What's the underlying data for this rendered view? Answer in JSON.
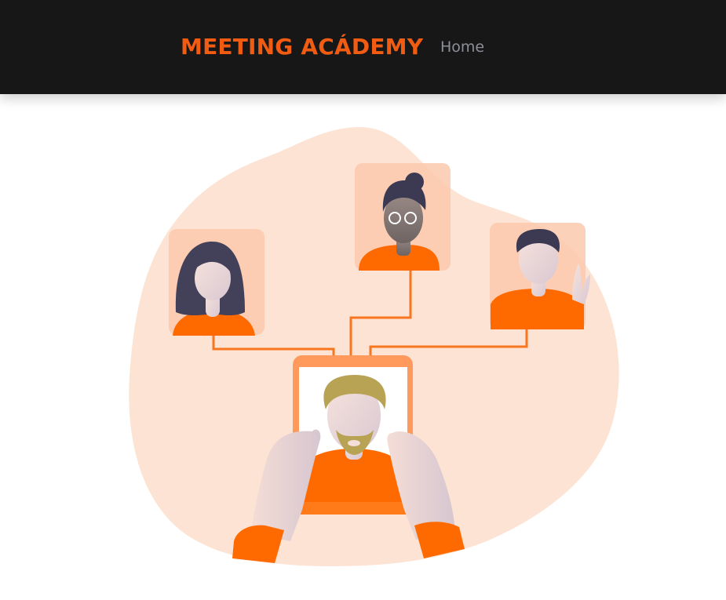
{
  "navbar": {
    "brand": "MEETING ACÁDEMY",
    "links": [
      "Home"
    ]
  },
  "hero": {
    "illustration": "video-conference-illustration"
  },
  "colors": {
    "nav_background": "#171717",
    "brand": "#f25c12",
    "nav_link": "#8d8f99",
    "accent_orange": "#ff6a00",
    "blob": "#fde3d3"
  }
}
